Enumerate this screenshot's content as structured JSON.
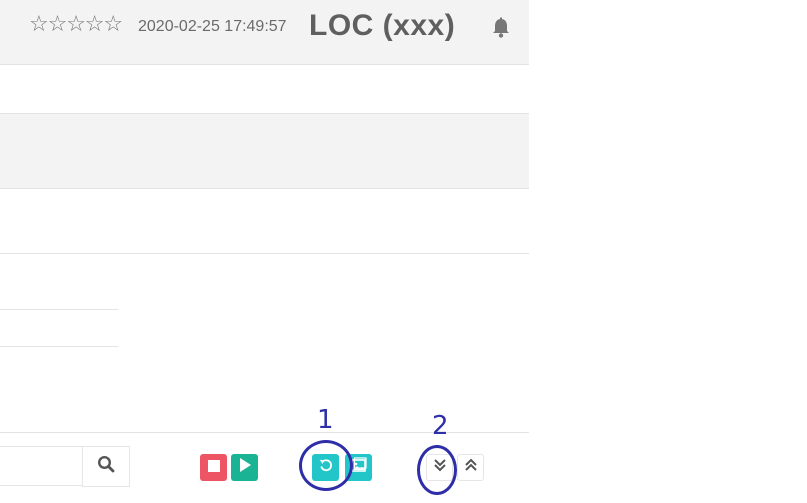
{
  "header": {
    "stars": [
      "☆",
      "☆",
      "☆",
      "☆",
      "☆"
    ],
    "timestamp": "2020-02-25 17:49:57",
    "title": "LOC  (xxx)",
    "bell_icon": "bell-icon"
  },
  "footer": {
    "search": {
      "value": "",
      "placeholder": ""
    },
    "search_icon": "search-icon",
    "buttons": [
      {
        "name": "stop-button",
        "icon": "stop-icon",
        "color": "#ed5565"
      },
      {
        "name": "play-button",
        "icon": "play-icon",
        "color": "#1ab394"
      },
      {
        "name": "reload-button",
        "icon": "reload-icon",
        "color": "#23c6c8"
      },
      {
        "name": "image-button",
        "icon": "image-icon",
        "color": "#23c6c8"
      },
      {
        "name": "scroll-down-button",
        "icon": "double-chevron-down-icon",
        "color": "#ffffff"
      },
      {
        "name": "scroll-up-button",
        "icon": "double-chevron-up-icon",
        "color": "#ffffff"
      }
    ]
  },
  "annotations": {
    "label_1": "1",
    "label_2": "2",
    "color": "#2e2ea8"
  }
}
